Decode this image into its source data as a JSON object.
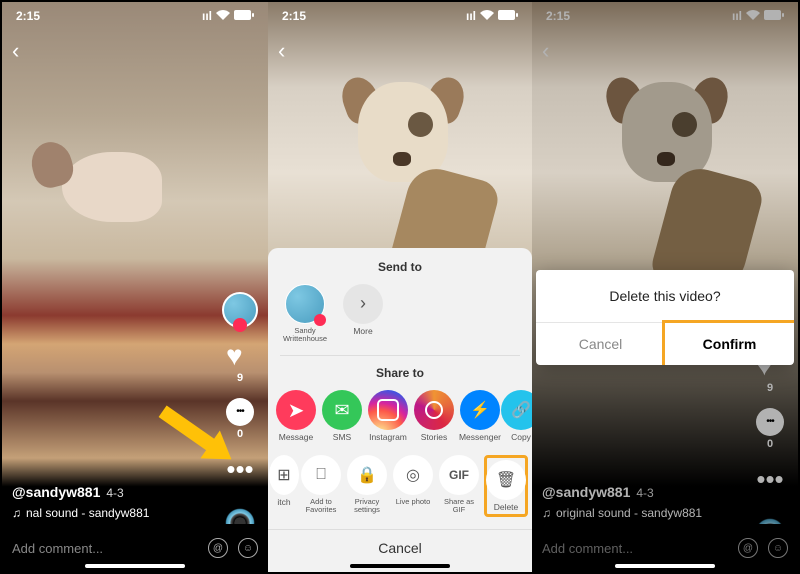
{
  "status": {
    "time": "2:15",
    "signal_icon": "signal-icon",
    "wifi_icon": "wifi-icon",
    "battery_icon": "battery-icon"
  },
  "screen1": {
    "rail": {
      "like_count": "9",
      "comment_count": "0"
    },
    "info": {
      "username": "@sandyw881",
      "date": "4-3",
      "sound": "nal sound - sandyw881"
    },
    "comment_placeholder": "Add comment..."
  },
  "screen2": {
    "send_to": {
      "title": "Send to",
      "items": [
        {
          "label": "Sandy Writtenhouse"
        },
        {
          "label": "More"
        }
      ]
    },
    "share_to": {
      "title": "Share to",
      "items": [
        {
          "label": "Message"
        },
        {
          "label": "SMS"
        },
        {
          "label": "Instagram"
        },
        {
          "label": "Stories"
        },
        {
          "label": "Messenger"
        },
        {
          "label": "Copy"
        }
      ]
    },
    "actions": {
      "items": [
        {
          "label": "itch"
        },
        {
          "label": "Add to Favorites"
        },
        {
          "label": "Privacy settings"
        },
        {
          "label": "Live photo"
        },
        {
          "label": "Share as GIF"
        },
        {
          "label": "Delete"
        }
      ]
    },
    "cancel": "Cancel"
  },
  "screen3": {
    "rail": {
      "like_count": "9",
      "comment_count": "0"
    },
    "info": {
      "username": "@sandyw881",
      "date": "4-3",
      "sound": "original sound - sandyw881"
    },
    "comment_placeholder": "Add comment...",
    "dialog": {
      "title": "Delete this video?",
      "cancel": "Cancel",
      "confirm": "Confirm"
    }
  }
}
